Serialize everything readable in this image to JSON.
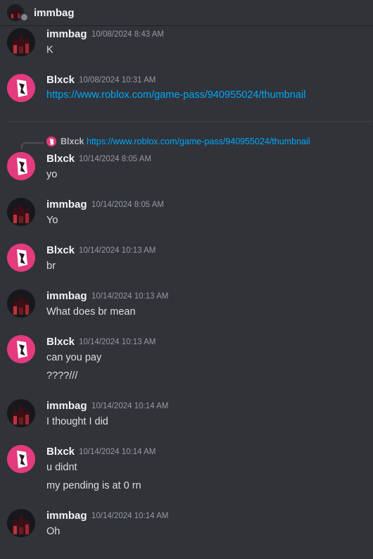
{
  "header": {
    "title": "immbag"
  },
  "reply": {
    "author": "Blxck",
    "text": "https://www.roblox.com/game-pass/940955024/thumbnail"
  },
  "messages": [
    {
      "author": "immbag",
      "timestamp": "10/08/2024 8:43 AM",
      "lines": [
        "K"
      ]
    },
    {
      "author": "Blxck",
      "timestamp": "10/08/2024 10:31 AM",
      "lines": [
        "https://www.roblox.com/game-pass/940955024/thumbnail"
      ]
    },
    {
      "author": "Blxck",
      "timestamp": "10/14/2024 8:05 AM",
      "lines": [
        "yo"
      ]
    },
    {
      "author": "immbag",
      "timestamp": "10/14/2024 8:05 AM",
      "lines": [
        "Yo"
      ]
    },
    {
      "author": "Blxck",
      "timestamp": "10/14/2024 10:13 AM",
      "lines": [
        "br"
      ]
    },
    {
      "author": "immbag",
      "timestamp": "10/14/2024 10:13 AM",
      "lines": [
        "What does br mean"
      ]
    },
    {
      "author": "Blxck",
      "timestamp": "10/14/2024 10:13 AM",
      "lines": [
        "can you pay",
        "????///"
      ]
    },
    {
      "author": "immbag",
      "timestamp": "10/14/2024 10:14 AM",
      "lines": [
        "I thought I did"
      ]
    },
    {
      "author": "Blxck",
      "timestamp": "10/14/2024 10:14 AM",
      "lines": [
        "u didnt",
        "my pending is at 0 rn"
      ]
    },
    {
      "author": "immbag",
      "timestamp": "10/14/2024 10:14 AM",
      "lines": [
        "Oh"
      ]
    }
  ]
}
